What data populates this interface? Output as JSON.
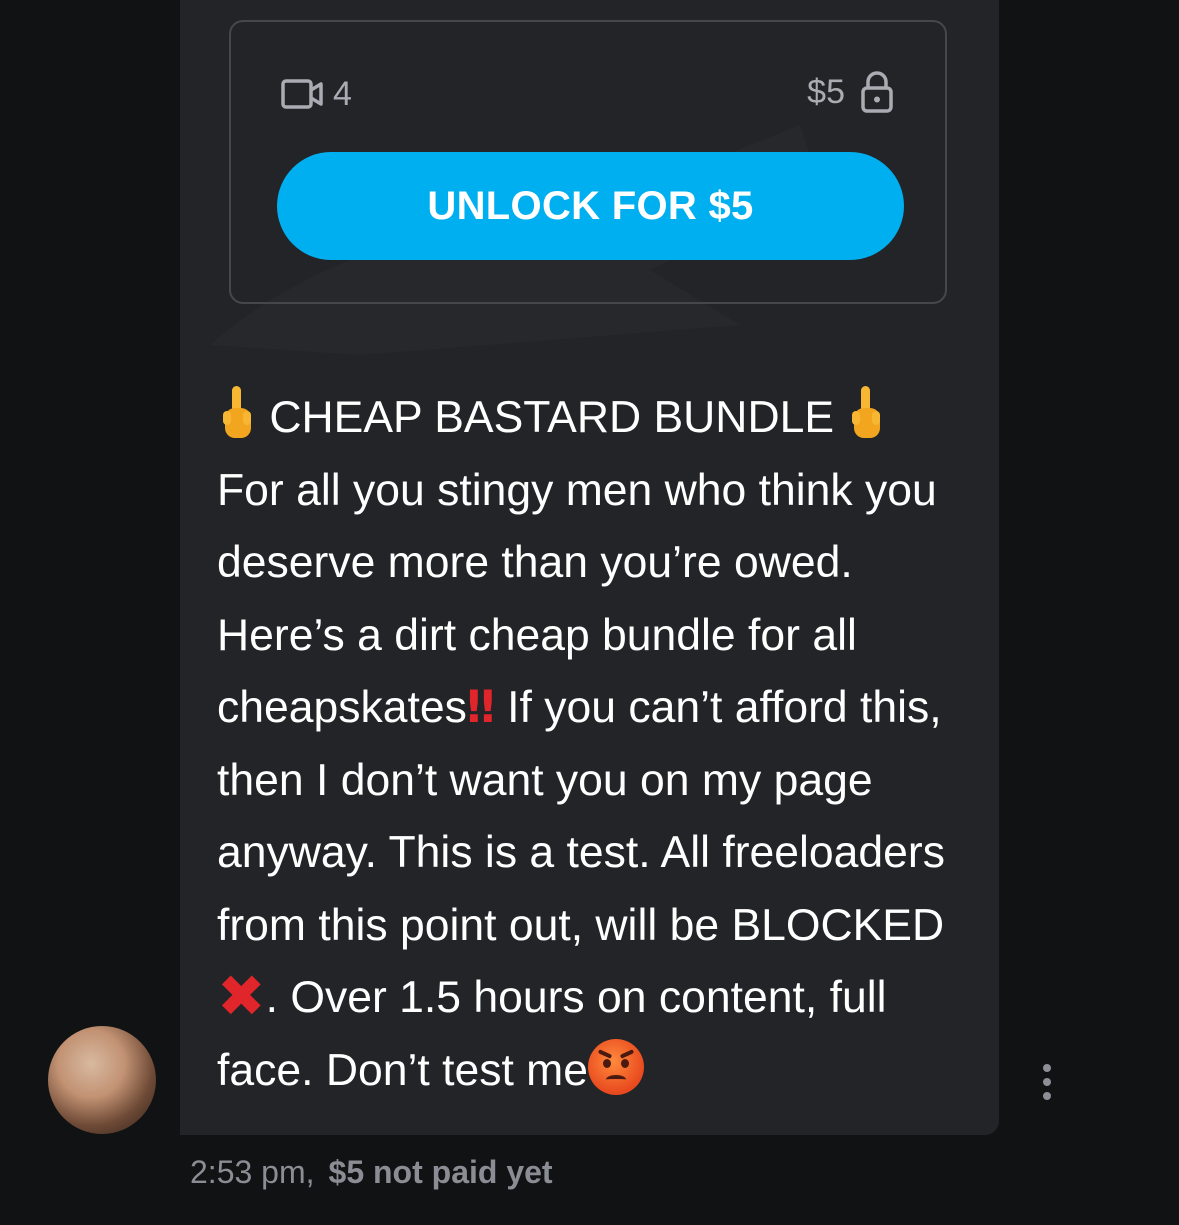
{
  "locked_media": {
    "video_count": "4",
    "price": "$5",
    "unlock_label": "UNLOCK FOR $5",
    "icons": [
      "video-icon",
      "lock-icon"
    ],
    "accent_color": "#00aff0"
  },
  "message": {
    "title": "CHEAP BASTARD BUNDLE",
    "text_1": "For all you stingy men who think you deserve more than you’re owed. Here’s a dirt cheap bundle for all cheapskates",
    "text_2": " If you can’t afford this, then I don’t want you on my page anyway. This is a test. All freeloaders from this point out, will be BLOCKED",
    "text_3": ". Over 1.5 hours on content, full face. Don’t test me",
    "emojis": [
      "middle-finger",
      "double-exclamation",
      "cross-mark",
      "angry-face"
    ]
  },
  "footer": {
    "time": "2:53 pm,",
    "paid_status": "$5 not paid yet"
  }
}
